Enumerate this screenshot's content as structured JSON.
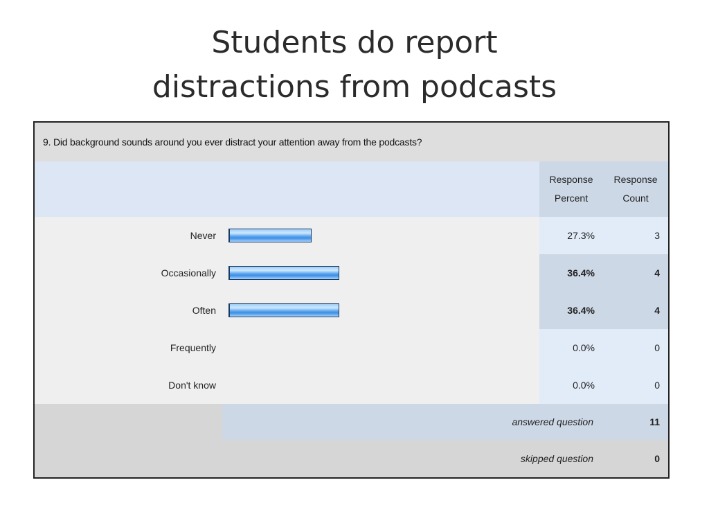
{
  "slide": {
    "title_lines": [
      "Students do report",
      "distractions from podcasts"
    ]
  },
  "survey": {
    "question": "9. Did background sounds around you ever distract your attention away from the podcasts?",
    "col_percent": "Response Percent",
    "col_count": "Response Count",
    "answered_label": "answered question",
    "answered_count": "11",
    "skipped_label": "skipped question",
    "skipped_count": "0"
  },
  "chart_data": {
    "type": "bar",
    "orientation": "horizontal",
    "title": "9. Did background sounds around you ever distract your attention away from the podcasts?",
    "categories": [
      "Never",
      "Occasionally",
      "Often",
      "Frequently",
      "Don't know"
    ],
    "values": [
      27.3,
      36.4,
      36.4,
      0.0,
      0.0
    ],
    "percent_labels": [
      "27.3%",
      "36.4%",
      "36.4%",
      "0.0%",
      "0.0%"
    ],
    "counts": [
      3,
      4,
      4,
      0,
      0
    ],
    "xlim": [
      0,
      100
    ],
    "grid": false,
    "legend": "none",
    "bar_color": "#5fa7ef",
    "bar_border": "#1a3a66"
  }
}
